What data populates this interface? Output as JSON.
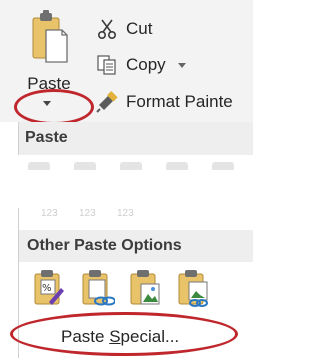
{
  "clipboard": {
    "paste_label": "Paste",
    "cut_label": "Cut",
    "copy_label": "Copy",
    "format_painter_label": "Format Painte"
  },
  "menu": {
    "paste_header": "Paste",
    "faded_values": [
      "123",
      "123",
      "123"
    ],
    "other_paste_options_header": "Other Paste Options",
    "paste_special": {
      "before": "Paste ",
      "accel": "S",
      "after": "pecial..."
    }
  },
  "colors": {
    "highlight_ring": "#c0272d",
    "ribbon_bg": "#f3f3f3",
    "header_bg": "#eeeeee"
  }
}
